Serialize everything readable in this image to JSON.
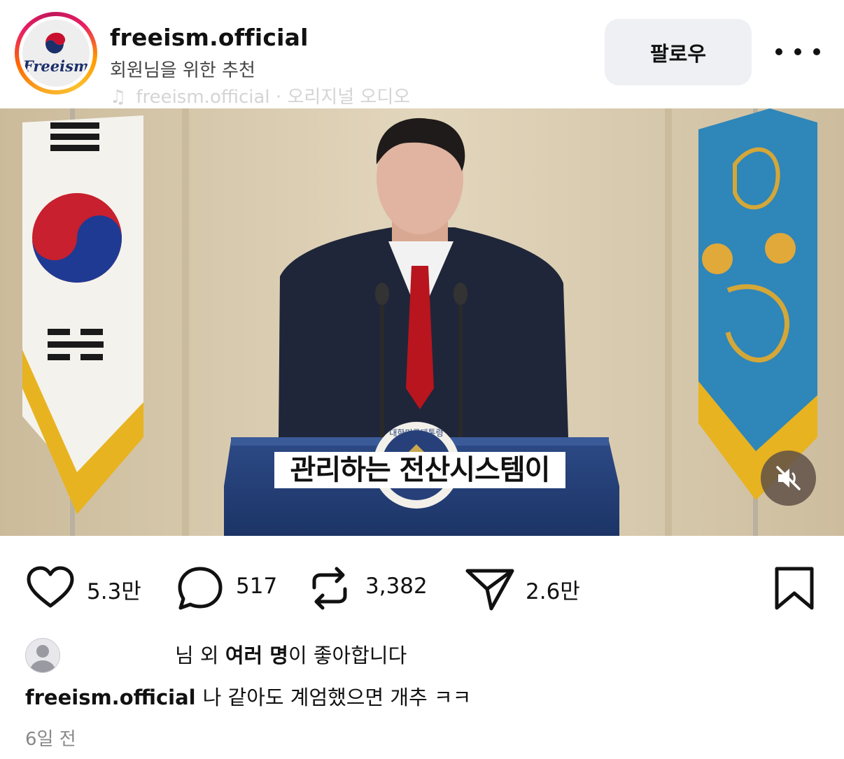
{
  "header": {
    "username": "freeism.official",
    "subtitle": "회원님을 위한 추천",
    "audio_label": "freeism.official · 오리지널 오디오",
    "avatar_logo_text": "Freeism",
    "follow_label": "팔로우"
  },
  "video": {
    "caption": "관리하는 전산시스템이",
    "podium_seal_text": "대한민국대통령",
    "muted": true
  },
  "actions": {
    "likes_count": "5.3만",
    "comments_count": "517",
    "reposts_count": "3,382",
    "shares_count": "2.6만"
  },
  "likes_line": {
    "name_fragment": "님",
    "middle": " 외 ",
    "emphasis": "여러 명",
    "suffix": "이 좋아합니다"
  },
  "post_caption": {
    "username": "freeism.official",
    "text": "나 같아도 계엄했으면 개추 ㅋㅋ"
  },
  "timestamp": "6일 전",
  "colors": {
    "follow_bg": "#eef0f3",
    "ring_gradient": [
      "#f9a825",
      "#e91e63"
    ],
    "logo_navy": "#1b2f6b"
  }
}
